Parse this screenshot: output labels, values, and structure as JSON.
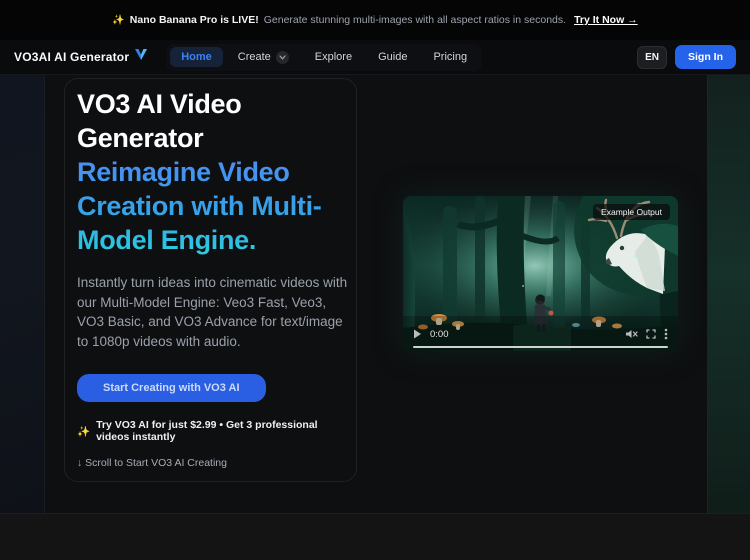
{
  "announcement": {
    "icon": "✨",
    "highlight": "Nano Banana Pro is LIVE!",
    "text": "Generate stunning multi-images with all aspect ratios in seconds.",
    "cta": "Try It Now →"
  },
  "navbar": {
    "brand": "VO3AI AI Generator",
    "items": [
      {
        "label": "Home"
      },
      {
        "label": "Create"
      },
      {
        "label": "Explore"
      },
      {
        "label": "Guide"
      },
      {
        "label": "Pricing"
      }
    ],
    "language": "EN",
    "sign_in": "Sign In"
  },
  "hero": {
    "title_line_white": "VO3 AI Video Generator",
    "title_line_gradient": "Reimagine Video Creation with Multi-Model Engine.",
    "description": "Instantly turn ideas into cinematic videos with our Multi-Model Engine: Veo3 Fast, Veo3, VO3 Basic, and VO3 Advance for text/image to 1080p videos with audio.",
    "cta_button": "Start Creating with VO3 AI",
    "offer_icon": "✨",
    "offer": "Try VO3 AI for just $2.99 • Get 3 professional videos instantly",
    "scroll_hint": "↓ Scroll to Start VO3 AI Creating"
  },
  "video_player": {
    "badge": "Example Output",
    "time": "0:00"
  },
  "colors": {
    "accent_blue": "#2563eb",
    "heading_gradient_start": "#4d8df4",
    "heading_gradient_end": "#2bcfdd",
    "sparkle_gold": "#f0a32e"
  }
}
